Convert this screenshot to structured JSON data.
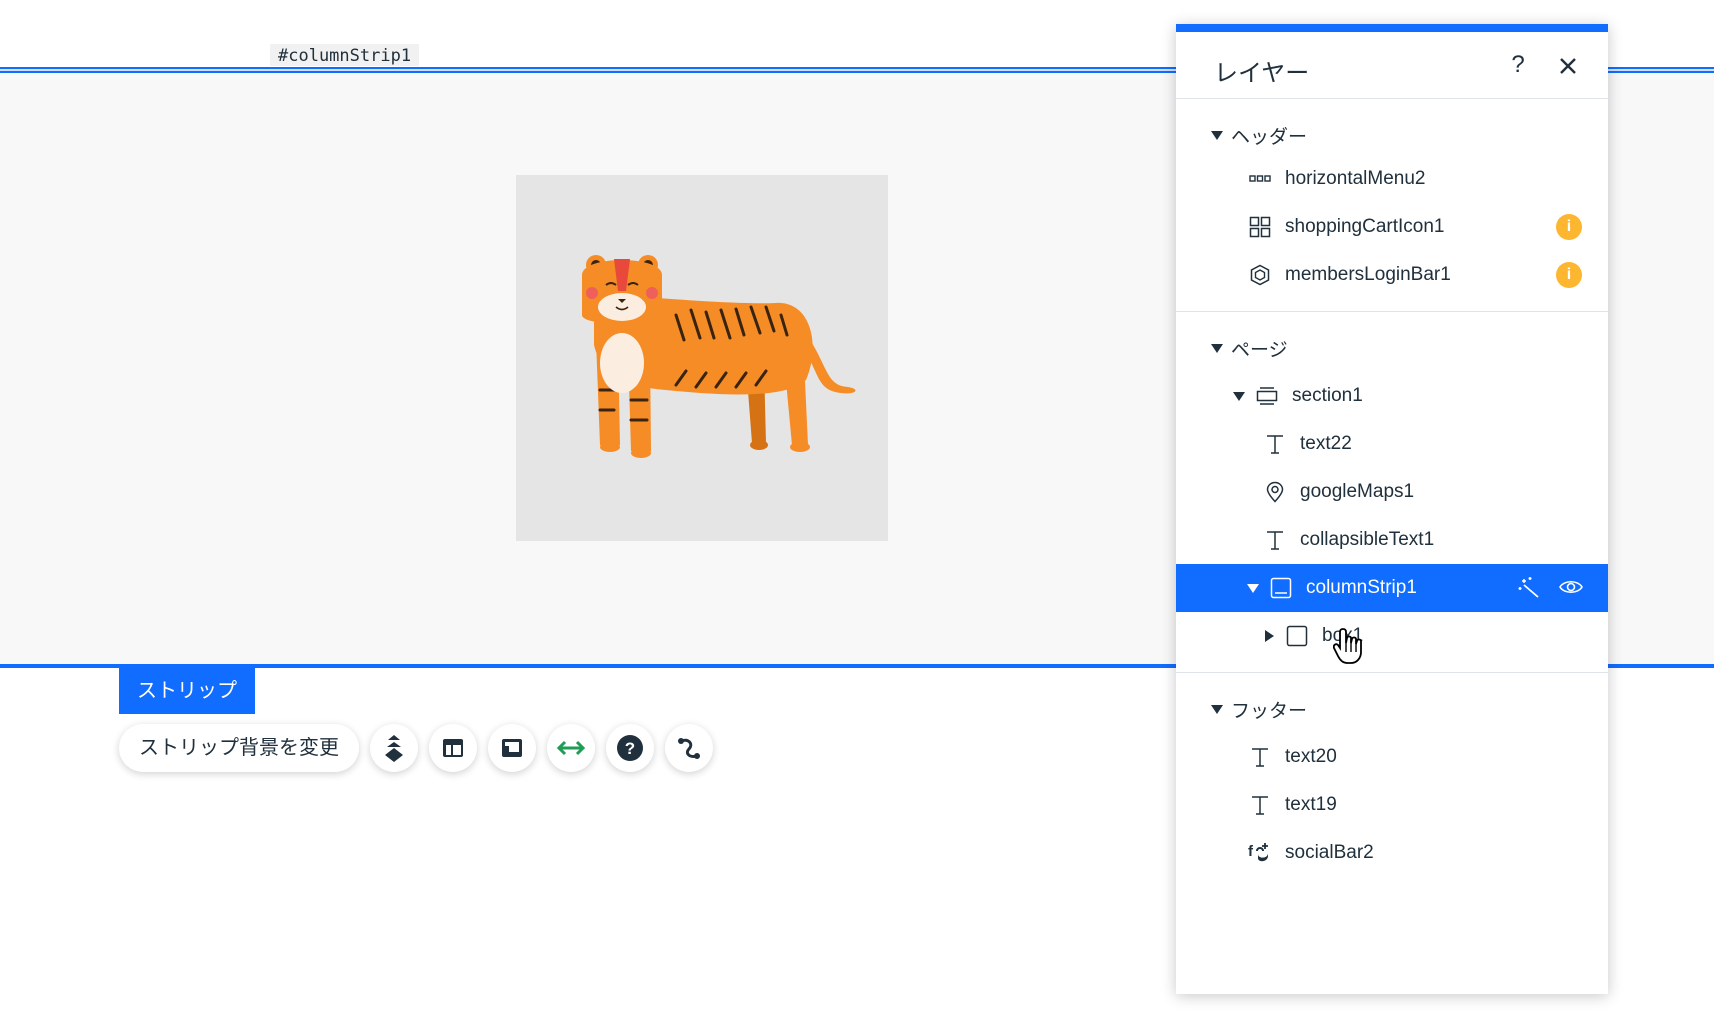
{
  "canvas": {
    "element_id": "#columnStrip1",
    "strip_label": "ストリップ",
    "toolbar": {
      "main_label": "ストリップ背景を変更",
      "buttons": [
        "layers-arrange-icon",
        "layout-icon",
        "column-icon",
        "stretch-icon",
        "help-icon",
        "animation-icon"
      ]
    }
  },
  "panel": {
    "title": "レイヤー",
    "help": "?",
    "sections": {
      "header": {
        "title": "ヘッダー",
        "items": [
          "horizontalMenu2",
          "shoppingCartIcon1",
          "membersLoginBar1"
        ]
      },
      "page": {
        "title": "ページ",
        "section_item": "section1",
        "items": [
          "text22",
          "googleMaps1",
          "collapsibleText1"
        ],
        "selected": "columnStrip1",
        "child": "box1"
      },
      "footer": {
        "title": "フッター",
        "items": [
          "text20",
          "text19",
          "socialBar2"
        ]
      }
    },
    "info_badge": "i"
  },
  "colors": {
    "accent": "#116dff",
    "badge": "#fdb62f",
    "tiger": "#f58c26"
  }
}
